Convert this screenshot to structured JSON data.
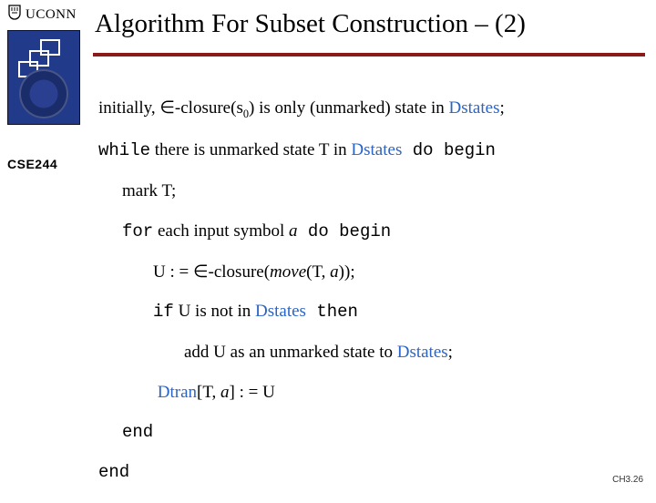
{
  "brand": {
    "uconn": "UCONN"
  },
  "course": "CSE244",
  "title": "Algorithm For Subset Construction – (2)",
  "ds_word": "Dstates",
  "dtran_word": "Dtran",
  "line1": {
    "a": "initially,  ",
    "closure_pre": "∈-closure(s",
    "closure_sub": "0",
    "b": ") is only (unmarked) state in ",
    "semi": ";"
  },
  "line2": {
    "kw_while": "while",
    "mid": " there is unmarked state T in ",
    "kw_do": " do begin"
  },
  "line3": "mark T;",
  "line4": {
    "kw_for": "for",
    "mid1": "  each input symbol ",
    "sym": "a",
    "kw_do": "  do begin"
  },
  "line5": {
    "a": "U : = ∈-closure(",
    "move": "move",
    "b": "(T, ",
    "sym": "a",
    "c": "));"
  },
  "line6": {
    "kw_if": "if",
    "mid": "  U is not in ",
    "kw_then": " then"
  },
  "line7": {
    "a": "add U as an unmarked state to ",
    "semi": ";"
  },
  "line8": {
    "a": "[T, ",
    "sym": "a",
    "b": "] : = U"
  },
  "end": "end",
  "footer": "CH3.26"
}
